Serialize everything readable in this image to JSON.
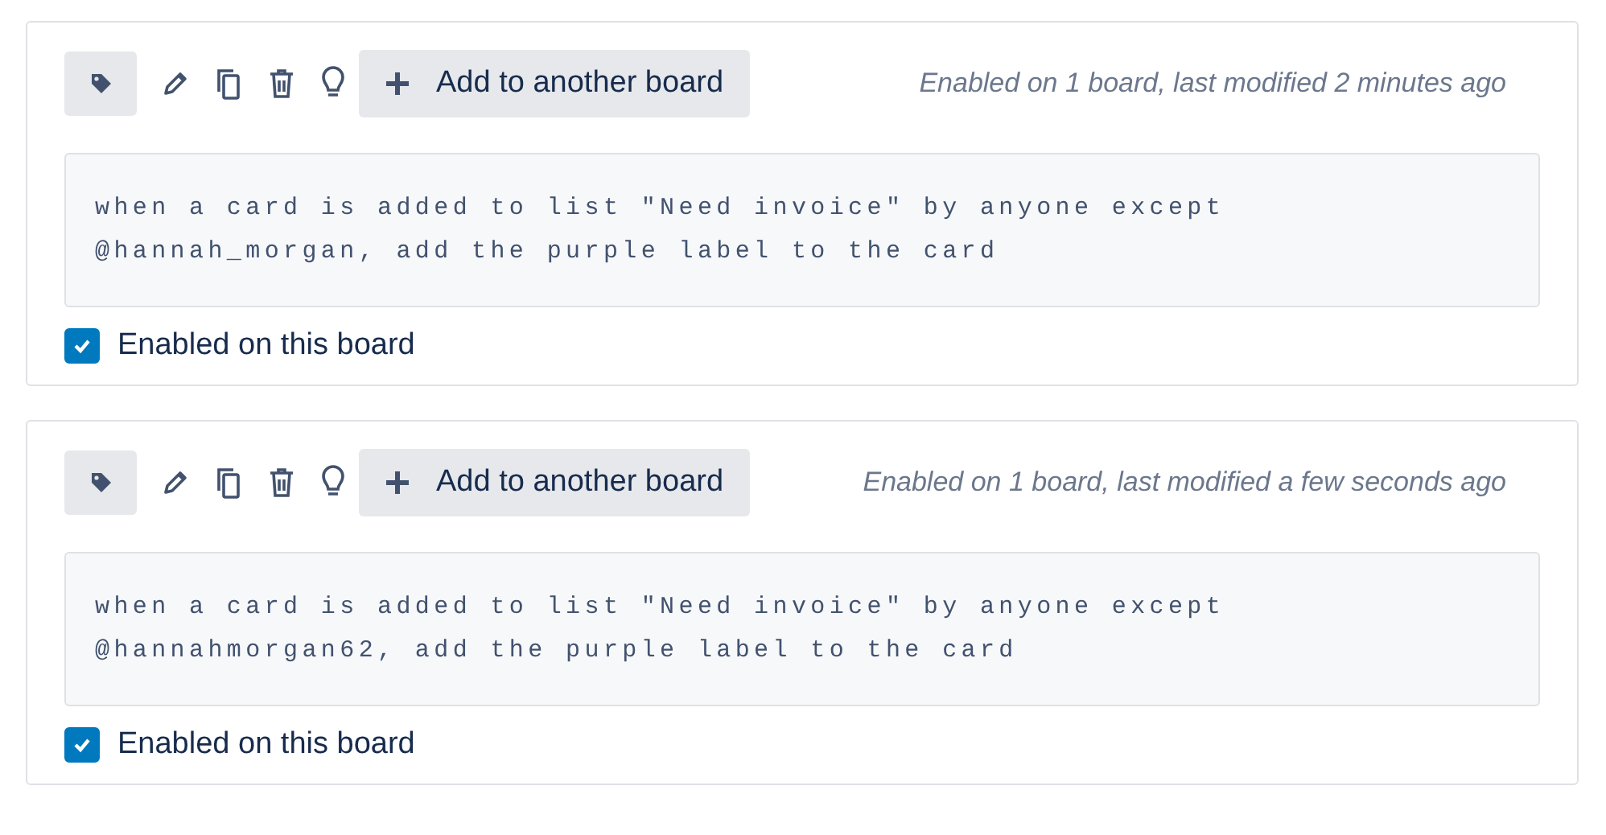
{
  "rules": [
    {
      "add_button": "Add to another board",
      "status": "Enabled on 1 board, last modified 2 minutes ago",
      "rule_text": "when a card is added to list \"Need invoice\" by anyone except @hannah_morgan, add the purple label to the card",
      "enabled": {
        "label": "Enabled on this board",
        "checked": true
      }
    },
    {
      "add_button": "Add to another board",
      "status": "Enabled on 1 board, last modified a few seconds ago",
      "rule_text": "when a card is added to list \"Need invoice\" by anyone except @hannahmorgan62, add the purple label to the card",
      "enabled": {
        "label": "Enabled on this board",
        "checked": true
      }
    }
  ]
}
